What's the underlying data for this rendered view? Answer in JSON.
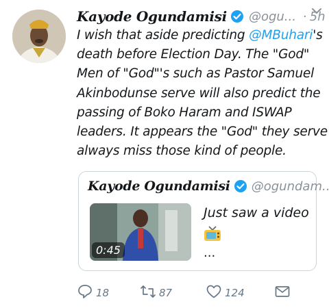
{
  "tweet": {
    "author_name": "Kayode Ogundamisi",
    "handle": "@ogu...",
    "separator": "·",
    "time": "5h",
    "text_lines": [
      {
        "pre": "I wish that aside predicting ",
        "mention": "@MBuhari",
        "post": "'s"
      },
      {
        "pre": "death before Election Day. The \"God\"",
        "mention": "",
        "post": ""
      },
      {
        "pre": "Men of \"God\"'s such as Pastor Samuel",
        "mention": "",
        "post": ""
      },
      {
        "pre": "Akinbodunse serve will also predict the",
        "mention": "",
        "post": ""
      },
      {
        "pre": "passing of Boko Haram and ISWAP",
        "mention": "",
        "post": ""
      },
      {
        "pre": "leaders. It appears the \"God\" they serve",
        "mention": "",
        "post": ""
      },
      {
        "pre": "always miss those kind of people.",
        "mention": "",
        "post": ""
      }
    ]
  },
  "quoted_tweet": {
    "author_name": "Kayode Ogundamisi",
    "handle": "@ogundam...",
    "video_duration": "0:45",
    "text": "Just saw a video",
    "ellipsis": "..."
  },
  "actions": {
    "reply_count": "18",
    "retweet_count": "87",
    "like_count": "124"
  },
  "colors": {
    "accent": "#1da1f2",
    "secondary_text": "#8a9199",
    "border": "#ccd6dd"
  },
  "icons": [
    "verified-badge-icon",
    "chevron-down-icon",
    "tv-emoji-icon",
    "reply-icon",
    "retweet-icon",
    "like-icon",
    "direct-message-icon"
  ]
}
